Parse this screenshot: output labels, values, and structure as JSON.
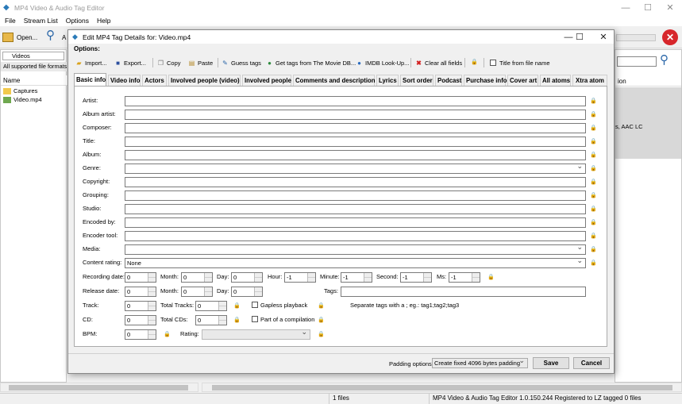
{
  "app": {
    "title": "MP4 Video & Audio Tag Editor",
    "menu": [
      "File",
      "Stream List",
      "Options",
      "Help"
    ],
    "toolbar_open": "Open...",
    "toolbar_next": "A",
    "folder_combo": "Videos",
    "filter": "All supported file formats",
    "list_header": "Name",
    "files": [
      "Captures",
      "Video.mp4"
    ],
    "right_header": "ion",
    "right_text": "s, AAC LC",
    "status_count": "1 files",
    "status_info": "MP4 Video & Audio Tag Editor 1.0.150.244 Registered to LZ tagged 0 files"
  },
  "dialog": {
    "title": "Edit MP4 Tag Details for: Video.mp4",
    "options_label": "Options:",
    "toolbar": [
      "Import...",
      "Export...",
      "Copy",
      "Paste",
      "Guess tags",
      "Get tags from The Movie DB...",
      "IMDB Look-Up...",
      "Clear all fields",
      "Title from file name"
    ],
    "tabs": [
      "Basic info",
      "Video info",
      "Actors",
      "Involved people (video)",
      "Involved people",
      "Comments and description",
      "Lyrics",
      "Sort order",
      "Podcast",
      "Purchase info",
      "Cover art",
      "All atoms",
      "Xtra atom"
    ],
    "fields": [
      "Artist:",
      "Album artist:",
      "Composer:",
      "Title:",
      "Album:",
      "Genre:",
      "Copyright:",
      "Grouping:",
      "Studio:",
      "Encoded by:",
      "Encoder tool:",
      "Media:",
      "Content rating:"
    ],
    "content_rating_value": "None",
    "recording": {
      "label": "Recording date:",
      "month": "Month:",
      "day": "Day:",
      "hour": "Hour:",
      "minute": "Minute:",
      "second": "Second:",
      "ms": "Ms:",
      "v_year": "0",
      "v_month": "0",
      "v_day": "0",
      "v_hour": "-1",
      "v_minute": "-1",
      "v_second": "-1",
      "v_ms": "-1"
    },
    "release": {
      "label": "Release date:",
      "month": "Month:",
      "day": "Day:",
      "tags": "Tags:",
      "v_year": "0",
      "v_month": "0",
      "v_day": "0"
    },
    "track": {
      "label": "Track:",
      "total": "Total Tracks:",
      "v": "0",
      "v_total": "0",
      "gapless": "Gapless playback",
      "hint": "Separate tags with a ; eg.: tag1;tag2;tag3"
    },
    "cd": {
      "label": "CD:",
      "total": "Total CDs:",
      "v": "0",
      "v_total": "0",
      "compilation": "Part of a compilation"
    },
    "bpm": {
      "label": "BPM:",
      "v": "0",
      "rating": "Rating:"
    },
    "padding_label": "Padding options:",
    "padding_value": "Create fixed 4096 bytes padding",
    "save": "Save",
    "cancel": "Cancel"
  }
}
